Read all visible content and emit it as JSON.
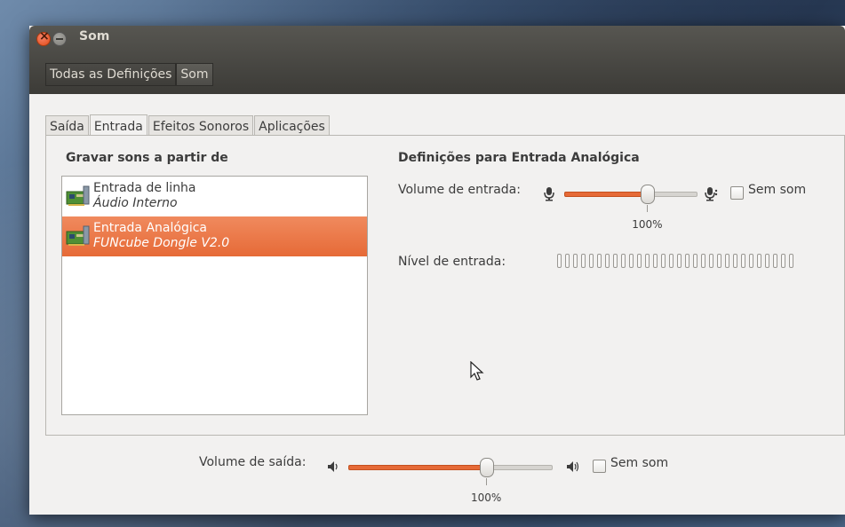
{
  "window": {
    "title": "Som",
    "breadcrumbs": [
      "Todas as Definições",
      "Som"
    ]
  },
  "tabs": [
    {
      "label": "Saída",
      "active": false
    },
    {
      "label": "Entrada",
      "active": true
    },
    {
      "label": "Efeitos Sonoros",
      "active": false
    },
    {
      "label": "Aplicações",
      "active": false
    }
  ],
  "input": {
    "list_heading": "Gravar sons a partir de",
    "devices": [
      {
        "name": "Entrada de linha",
        "subtitle": "Áudio Interno",
        "selected": false
      },
      {
        "name": "Entrada Analógica",
        "subtitle": "FUNcube Dongle V2.0",
        "selected": true
      }
    ],
    "settings_heading": "Definições para Entrada Analógica",
    "volume_label": "Volume de entrada:",
    "volume_percent": 100,
    "volume_percent_label": "100%",
    "mute_label": "Sem som",
    "mute_checked": false,
    "level_label": "Nível de entrada:",
    "level_segments": 30,
    "level_lit": 0
  },
  "output": {
    "volume_label": "Volume de saída:",
    "volume_percent": 100,
    "volume_percent_label": "100%",
    "mute_label": "Sem som",
    "mute_checked": false
  },
  "colors": {
    "accent": "#e66a37",
    "titlebar": "#3c3b37",
    "window_bg": "#f2f1f0"
  },
  "icons": {
    "close": "close-icon",
    "minimize": "minimize-icon",
    "device": "sound-card-icon",
    "microphone": "microphone-icon",
    "speaker": "speaker-icon"
  }
}
